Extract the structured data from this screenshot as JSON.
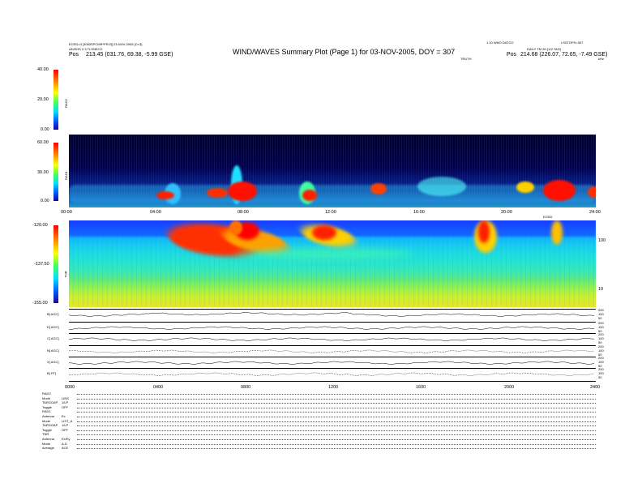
{
  "header": {
    "title": "WIND/WAVES Summary Plot (Page 1) for 03-NOV-2005, DOY = 307",
    "left_line1": "EOSD=3 [3063SPCMR*PRJ3] 23-NOV-2005 [Cr:3]",
    "left_line2": "AD/EHS 2.3 TLSNECS",
    "left_pos_label": "Pos",
    "left_pos_values": "213.45 (031.76, 69.38, -5.99 GSE)",
    "right_line1": "LSSTOPS=307",
    "right_line1b": "1.10 WNO DATCO",
    "right_line2": "DAILY TM 2K [1/0 TAG]",
    "right_pos_label": "Pos",
    "right_pos_values": "214.68 (226.07, 72.65, -7.49 GSE)",
    "mid_label": "TRUTH",
    "khz_label": "kHz",
    "tnr_top_label": "EOSD"
  },
  "rad2": {
    "label": "RAD2",
    "ticks": [
      "40.00",
      "20.00",
      "0.00"
    ]
  },
  "rad1": {
    "label": "RAD1",
    "ticks": [
      "60.00",
      "30.00",
      "0.00"
    ]
  },
  "time_axis": {
    "labels": [
      "00:00",
      "04:00",
      "08:00",
      "12:00",
      "16:00",
      "20:00",
      "24:00"
    ]
  },
  "tnr": {
    "label": "TNR",
    "ticks": [
      "-120.00",
      "-137.50",
      "-155.00"
    ],
    "right_ticks": [
      "100",
      "10"
    ]
  },
  "line_panels": [
    {
      "label": "B[ AGC]",
      "right_ticks": [
        "200",
        "100",
        "50"
      ]
    },
    {
      "label": "D[ AGC]",
      "right_ticks": [
        "200",
        "100",
        "50"
      ]
    },
    {
      "label": "C[ AGC]",
      "right_ticks": [
        "200",
        "100",
        "50"
      ]
    },
    {
      "label": "N[ AGC]",
      "right_ticks": [
        "200",
        "100",
        "50"
      ]
    },
    {
      "label": "X[ AGC]",
      "right_ticks": [
        "200",
        "100",
        "50"
      ]
    },
    {
      "label": "B[ FF]",
      "right_ticks": [
        "200",
        "100",
        "50"
      ]
    }
  ],
  "bottom_axis": {
    "labels": [
      "0000",
      "0400",
      "0800",
      "1200",
      "1600",
      "2000",
      "2400"
    ]
  },
  "info": [
    {
      "label": "RAD2",
      "value": ""
    },
    {
      "label": "Mode",
      "value": "LINS"
    },
    {
      "label": "TARGGAP",
      "value": "1/LP"
    },
    {
      "label": "Toggle",
      "value": "OFF"
    },
    {
      "label": "RAD1",
      "value": ""
    },
    {
      "label": "Antenna",
      "value": "Ex"
    },
    {
      "label": "Mode",
      "value": "LIST_A"
    },
    {
      "label": "TARGGAP",
      "value": "1/LP"
    },
    {
      "label": "Toggle",
      "value": "OFF"
    },
    {
      "label": "TNR",
      "value": ""
    },
    {
      "label": "Antenna",
      "value": "Ex/Ey"
    },
    {
      "label": "Mode",
      "value": "A-D"
    },
    {
      "label": "Average",
      "value": "ACE"
    }
  ],
  "chart_data": {
    "type": "heatmap",
    "title": "WIND/WAVES Summary Plot (Page 1) for 03-NOV-2005, DOY = 307",
    "x_range_hours": [
      0,
      24
    ],
    "panels": [
      {
        "name": "RAD2",
        "ylim": [
          0,
          40
        ]
      },
      {
        "name": "RAD1",
        "ylim": [
          0,
          60
        ]
      },
      {
        "name": "TNR",
        "ylim": [
          -155,
          -120
        ]
      }
    ],
    "bursts_hours": [
      1.3,
      4.3,
      4.6,
      6.5,
      7.6,
      10.3,
      17.8,
      19.6,
      20.3,
      22.5,
      23.1
    ]
  },
  "colors": {
    "rad_bg": "#0b22c8",
    "tnr_mid": "#20e0d8",
    "hot": "#ff0000"
  }
}
